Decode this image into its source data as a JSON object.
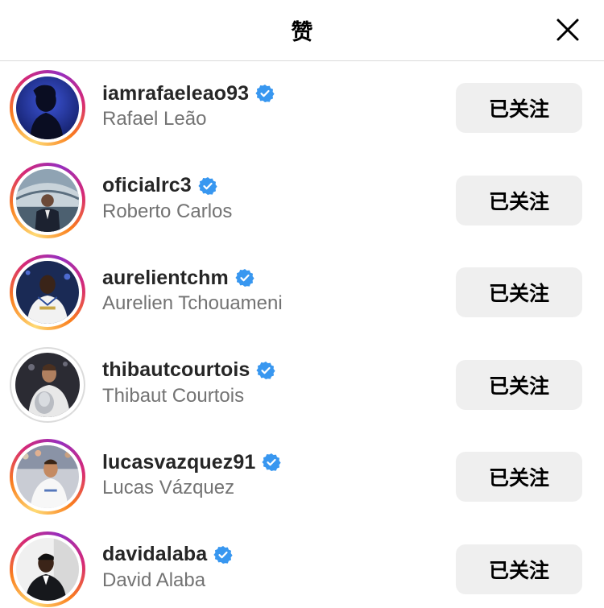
{
  "header": {
    "title": "赞"
  },
  "colors": {
    "verified": "#3897f0",
    "button_bg": "#efefef",
    "secondary_text": "#737373"
  },
  "users": [
    {
      "username": "iamrafaeleao93",
      "fullname": "Rafael Leão",
      "button": "已关注",
      "story_ring": true,
      "avatar": "silhouette"
    },
    {
      "username": "oficialrc3",
      "fullname": "Roberto Carlos",
      "button": "已关注",
      "story_ring": true,
      "avatar": "stadium"
    },
    {
      "username": "aurelientchm",
      "fullname": "Aurelien Tchouameni",
      "button": "已关注",
      "story_ring": true,
      "avatar": "player-dark"
    },
    {
      "username": "thibautcourtois",
      "fullname": "Thibaut Courtois",
      "button": "已关注",
      "story_ring": false,
      "avatar": "trophy"
    },
    {
      "username": "lucasvazquez91",
      "fullname": "Lucas Vázquez",
      "button": "已关注",
      "story_ring": true,
      "avatar": "player-white"
    },
    {
      "username": "davidalaba",
      "fullname": "David Alaba",
      "button": "已关注",
      "story_ring": true,
      "avatar": "suit"
    }
  ]
}
